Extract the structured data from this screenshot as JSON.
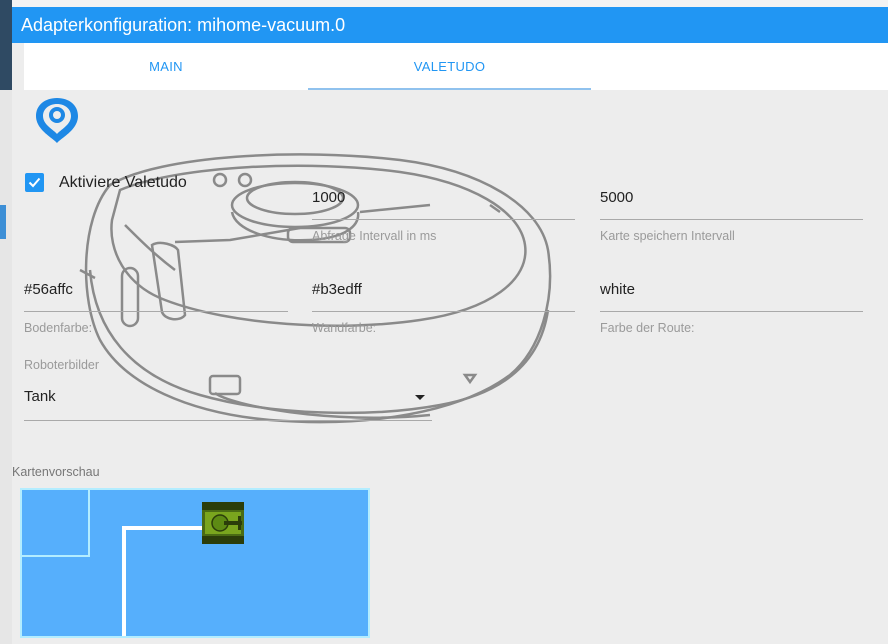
{
  "window": {
    "title": "Adapterkonfiguration: mihome-vacuum.0"
  },
  "tabs": [
    {
      "label": "MAIN",
      "active": false
    },
    {
      "label": "VALETUDO",
      "active": true
    }
  ],
  "colors": {
    "accent": "#2196f3",
    "floor": "#56affc",
    "wall": "#b3edff",
    "route": "white"
  },
  "logo": {
    "icon": "valetudo-logo-icon"
  },
  "enable_valetudo": {
    "label": "Aktiviere Valetudo",
    "checked": true
  },
  "fields": {
    "abfrage_intervall": {
      "value": "1000",
      "label": "Abfrage Intervall in ms"
    },
    "karte_intervall": {
      "value": "5000",
      "label": "Karte speichern Intervall"
    },
    "bodenfarbe": {
      "value": "#56affc",
      "label": "Bodenfarbe:"
    },
    "wandfarbe": {
      "value": "#b3edff",
      "label": "Wandfarbe:"
    },
    "routenfarbe": {
      "value": "white",
      "label": "Farbe der Route:"
    }
  },
  "roboterbilder": {
    "label": "Roboterbilder",
    "selected": "Tank"
  },
  "map_preview": {
    "label": "Kartenvorschau",
    "robot_icon": "tank-icon"
  }
}
